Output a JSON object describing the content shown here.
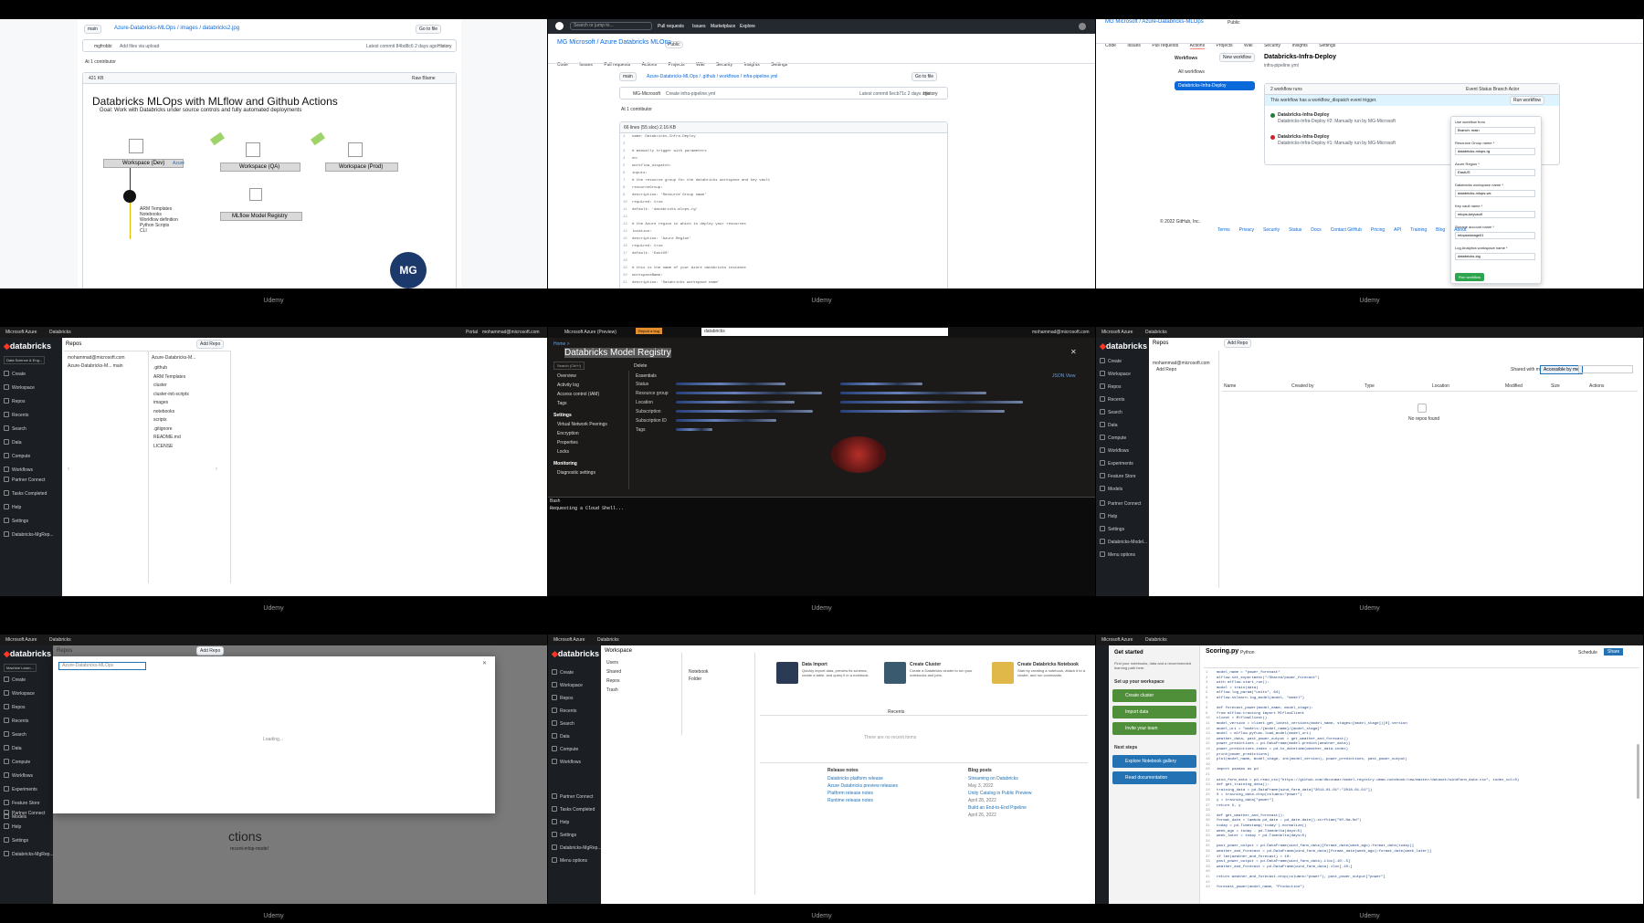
{
  "watermark": "Udemy",
  "tiles": {
    "t1": {
      "branch": "main",
      "breadcrumb": "Azure-Databricks-MLOps / images / databricks2.jpg",
      "goto_file": "Go to file",
      "commit_author": "mgfrobbi",
      "commit_msg": "Add files via upload",
      "commit_meta": "Latest commit 84bd8c6 2 days ago",
      "history": "History",
      "contributors": "At 1 contributor",
      "size": "421 KB",
      "open_btn": "Raw  Blame",
      "diagram_title": "Databricks MLOps with MLflow and Github Actions",
      "diagram_subtitle": "Goal: Work with Databricks under source controls and fully automated deployments",
      "ws_dev": "Workspace (Dev)",
      "ws_qa": "Workspace (QA)",
      "ws_prod": "Workspace (Prod)",
      "registry": "MLflow Model Registry",
      "az_tag": "Azure",
      "git_list": [
        "ARM Templates",
        "Notebooks",
        "Workflow definition",
        "Python Scripts",
        "CLI"
      ],
      "badge": "MG"
    },
    "t2": {
      "search": "Search or jump to...",
      "nav": [
        "Pull requests",
        "Issues",
        "Marketplace",
        "Explore"
      ],
      "repo": "MG Microsoft / Azure Databricks MLOps",
      "visibility": "Public",
      "tabs": [
        "Code",
        "Issues",
        "Pull requests",
        "Actions",
        "Projects",
        "Wiki",
        "Security",
        "Insights",
        "Settings"
      ],
      "branch": "main",
      "path": "Azure-Databricks-MLOps / .github / workflows / infra-pipeline.yml",
      "goto_file": "Go to file",
      "commit_author": "MG-Microsoft",
      "commit_msg": "Create infra-pipeline.yml",
      "commit_meta": "Latest commit 6ecb71c 2 days ago",
      "history": "History",
      "contributors": "At 1 contributor",
      "file_meta": "66 lines (55 sloc)  2.16 KB",
      "code": [
        "name: Databricks-Infra-Deploy",
        "",
        "# manually trigger with parameters",
        "on:",
        "  workflow_dispatch:",
        "  inputs:",
        "    # the resource group for the databricks workspace and key vault",
        "    resourceGroup:",
        "      description: 'Resource Group name'",
        "      required: true",
        "      default: 'databricks-mlops-rg'",
        "",
        "    # the Azure region in which to deploy your resources",
        "    location:",
        "      description: 'Azure Region'",
        "      required: true",
        "      default: 'EastUS'",
        "",
        "    # this is the name of your Azure databricks instance",
        "    workspaceName:",
        "      description: 'Databricks workspace name'"
      ]
    },
    "t3": {
      "repo": "MG Microsoft / Azure-Databricks-MLOps",
      "visibility": "Public",
      "tabs": [
        "Code",
        "Issues",
        "Pull requests",
        "Actions",
        "Projects",
        "Wiki",
        "Security",
        "Insights",
        "Settings"
      ],
      "sidebar_title": "Workflows",
      "new_workflow": "New workflow",
      "all_workflows": "All workflows",
      "workflow_item": "Databricks-Infra-Deploy",
      "page_title": "Databricks-Infra-Deploy",
      "page_sub": "infra-pipeline.yml",
      "runs_count": "2 workflow runs",
      "filter": "Event  Status  Branch  Actor",
      "notice": "This workflow has a workflow_dispatch event trigger.",
      "run_btn": "Run workflow",
      "run1": "Databricks-Infra-Deploy",
      "run1_sub": "Databricks-Infra-Deploy #2: Manually run by MG-Microsoft",
      "run2": "Databricks-Infra-Deploy",
      "run2_sub": "Databricks-Infra-Deploy #1: Manually run by MG-Microsoft",
      "form_fields": [
        {
          "label": "Use workflow from",
          "value": "Branch: main"
        },
        {
          "label": "Resource Group name *",
          "value": "databricks-mlops-rg"
        },
        {
          "label": "Azure Region *",
          "value": "EastUS"
        },
        {
          "label": "Databricks workspace name *",
          "value": "databricks-mlops-ws"
        },
        {
          "label": "Key vault name *",
          "value": "mlops-keyvault"
        },
        {
          "label": "Storage account name *",
          "value": "mlopsstorage01"
        },
        {
          "label": "Log Analytics workspace name *",
          "value": "databricks-log"
        }
      ],
      "form_submit": "Run workflow",
      "footer": "© 2022 GitHub, Inc.",
      "footer_links": [
        "Terms",
        "Privacy",
        "Security",
        "Status",
        "Docs",
        "Contact GitHub",
        "Pricing",
        "API",
        "Training",
        "Blog",
        "About"
      ]
    },
    "t4": {
      "portal": "Microsoft Azure",
      "product": "Databricks",
      "portal_link": "Portal",
      "user": "mohammad@microsoft.com",
      "logo": "databricks",
      "persona": "Data Science & Eng...",
      "nav": [
        "Create",
        "Workspace",
        "Repos",
        "Recents",
        "Search",
        "Data",
        "Compute",
        "Workflows"
      ],
      "bottom_nav": [
        "Partner Connect",
        "Tasks Completed",
        "Help",
        "Settings",
        "Databricks-MgRep..."
      ],
      "page_title": "Repos",
      "add_repo": "Add Repo",
      "col1_header": "mohammad@microsoft.com",
      "col1_item": "Azure-Databricks-M...  main",
      "col2_header": "Azure-Databricks-M...",
      "col2_items": [
        ".github",
        "ARM Templates",
        "cluster",
        "cluster-init-scripts",
        "images",
        "notebooks",
        "scripts",
        ".gitignore",
        "README.md",
        "LICENSE"
      ]
    },
    "t5": {
      "portal": "Microsoft Azure (Preview)",
      "badge": "Report a bug",
      "search": "databricks",
      "user": "mohammad@microsoft.com",
      "breadcrumb": "Home >",
      "title": "Databricks Model Registry",
      "search_res": "Search (Ctrl+/)",
      "delete": "Delete",
      "nav": [
        "Overview",
        "Activity log",
        "Access control (IAM)",
        "Tags"
      ],
      "settings_head": "Settings",
      "settings": [
        "Virtual Network Peerings",
        "Encryption",
        "Properties",
        "Locks"
      ],
      "monitoring_head": "Monitoring",
      "monitoring": [
        "Diagnostic settings"
      ],
      "essentials": "Essentials",
      "rows": [
        "Status",
        "Resource group",
        "Location",
        "Subscription",
        "Subscription ID",
        "Tags"
      ],
      "json_view": "JSON View",
      "shell": "Bash",
      "shell_line": "Requesting a Cloud Shell..."
    },
    "t6": {
      "portal": "Microsoft Azure",
      "product": "Databricks",
      "logo": "databricks",
      "nav": [
        "Create",
        "Workspace",
        "Repos",
        "Recents",
        "Search",
        "Data",
        "Compute",
        "Workflows",
        "Experiments",
        "Feature Store",
        "Models"
      ],
      "bottom_nav": [
        "Partner Connect",
        "Help",
        "Settings",
        "Databricks-Model...",
        "Menu options"
      ],
      "page_title": "Repos",
      "add_repo": "Add Repo",
      "user_folder": "mohammad@microsoft.com",
      "add_label": "Add Repo",
      "tab1": "Shared with me",
      "tab2": "Accessible by me",
      "columns": [
        "Name",
        "Created by",
        "Type",
        "Location",
        "Modified",
        "Size",
        "Actions"
      ],
      "empty": "No repos found"
    },
    "t7": {
      "portal": "Microsoft Azure",
      "product": "Databricks",
      "logo": "databricks",
      "persona": "Machine Learn...",
      "nav": [
        "Create",
        "Workspace",
        "Repos",
        "Recents",
        "Search",
        "Data",
        "Compute",
        "Workflows",
        "Experiments",
        "Feature Store",
        "Models"
      ],
      "bottom_nav": [
        "Partner Connect",
        "Help",
        "Settings",
        "Databricks-MgRep..."
      ],
      "page_title": "Repos",
      "add_repo": "Add Repo",
      "modal_title": "Azure-Databricks-MLOps",
      "loading": "Loading...",
      "bg_text": "ctions",
      "bg_sub": "recent-mlop-model"
    },
    "t8": {
      "portal": "Microsoft Azure",
      "product": "Databricks",
      "logo": "databricks",
      "nav": [
        "Create",
        "Workspace",
        "Repos",
        "Recents",
        "Search",
        "Data",
        "Compute",
        "Workflows"
      ],
      "bottom_nav": [
        "Partner Connect",
        "Tasks Completed",
        "Help",
        "Settings",
        "Databricks-MgRep...",
        "Menu options"
      ],
      "page_title": "Workspace",
      "col_items": [
        "Users",
        "Shared",
        "Repos",
        "Trash"
      ],
      "col2_items": [
        "Notebook",
        "Folder"
      ],
      "cards": [
        {
          "title": "Data Import",
          "body": "Quickly import data, preview its schema, create a table, and query it in a notebook."
        },
        {
          "title": "Create Cluster",
          "body": "Create a Databricks cluster to run your notebooks and jobs."
        },
        {
          "title": "Create Databricks Notebook",
          "body": "Start by creating a notebook, attach it to a cluster, and run commands."
        }
      ],
      "recents_head": "Recents",
      "recents_empty": "There are no recent items",
      "release_head": "Release notes",
      "release_items": [
        "Databricks platform release",
        "Azure Databricks preview releases",
        "Platform release notes",
        "Runtime release notes"
      ],
      "blog_head": "Blog posts",
      "blog_items": [
        "Streaming on Databricks",
        "May 3, 2022",
        "Unity Catalog in Public Preview",
        "April 28, 2022",
        "Build an End-to-End Pipeline",
        "April 26, 2022"
      ]
    },
    "t9": {
      "portal": "Microsoft Azure",
      "product": "Databricks",
      "panel_title": "Get started",
      "panel_intro": "Find your notebooks, data and a recommended learning path here.",
      "setup_head": "Set up your workspace",
      "setup_items": [
        "Create cluster",
        "Import data",
        "Invite your team"
      ],
      "next_head": "Next steps",
      "next_items": [
        "Explore Notebook gallery",
        "Read documentation"
      ],
      "file_title": "Scoring.py",
      "lang": "Python",
      "schedule": "Schedule",
      "share": "Share",
      "code": [
        "    model_name = \"power_forecast\"",
        "    mlflow.set_experiment(\"/Shared/power_forecast\")",
        "    with mlflow.start_run():",
        "        model = train(data)",
        "        mlflow.log_param(\"units\", 64)",
        "        mlflow.sklearn.log_model(model, \"model\")",
        "",
        "def forecast_power(model_name, model_stage):",
        "    from mlflow.tracking import MlflowClient",
        "    client = MlflowClient()",
        "    model_version = client.get_latest_versions(model_name, stages=[model_stage])[0].version",
        "    model_uri = \"models:/{model_name}/{model_stage}\"",
        "    model = mlflow.pyfunc.load_model(model_uri)",
        "    weather_data, past_power_output = get_weather_and_forecast()",
        "    power_predictions = pd.DataFrame(model.predict(weather_data))",
        "    power_predictions.index = pd.to_datetime(weather_data.index)",
        "    print(power_predictions)",
        "    plot(model_name, model_stage, int(model_version), power_predictions, past_power_output)",
        "",
        "import pandas as pd",
        "",
        "wind_farm_data = pd.read_csv(\"https://github.com/dbczumar/model-registry-demo-notebook/raw/master/dataset/windfarm_data.csv\", index_col=0)",
        "def get_training_data():",
        "    training_data = pd.DataFrame(wind_farm_data[\"2014-01-01\":\"2018-01-01\"])",
        "    X = training_data.drop(columns=\"power\")",
        "    y = training_data[\"power\"]",
        "    return X, y",
        "",
        "def get_weather_and_forecast():",
        "    format_date = lambda pd_date : pd_date.date().strftime(\"%Y-%m-%d\")",
        "    today = pd.Timestamp('today').normalize()",
        "    week_ago = today - pd.Timedelta(days=5)",
        "    week_later = today + pd.Timedelta(days=5)",
        "",
        "    past_power_output = pd.DataFrame(wind_farm_data)[format_date(week_ago):format_date(today)]",
        "    weather_and_forecast = pd.DataFrame(wind_farm_data)[format_date(week_ago):format_date(week_later)]",
        "    if len(weather_and_forecast) < 10:",
        "        past_power_output = pd.DataFrame(wind_farm_data).iloc[-10:-5]",
        "        weather_and_forecast = pd.DataFrame(wind_farm_data).iloc[-10:]",
        "",
        "    return weather_and_forecast.drop(columns=\"power\"), past_power_output[\"power\"]",
        "",
        "forecast_power(model_name, \"Production\")"
      ]
    }
  }
}
